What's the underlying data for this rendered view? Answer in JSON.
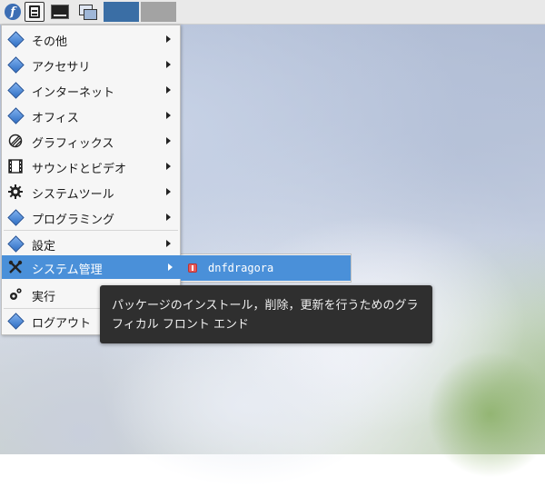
{
  "panel": {
    "launcher_icon": "fedora-icon",
    "files_icon": "file-manager-icon",
    "terminal_icon": "terminal-icon",
    "windows_icon": "show-desktop-icon",
    "workspace_active_color": "#3a6ea5",
    "workspace_inactive_color": "#a3a3a3"
  },
  "menu": {
    "items": [
      {
        "label": "その他",
        "icon": "category-icon",
        "has_submenu": true
      },
      {
        "label": "アクセサリ",
        "icon": "category-icon",
        "has_submenu": true
      },
      {
        "label": "インターネット",
        "icon": "category-icon",
        "has_submenu": true
      },
      {
        "label": "オフィス",
        "icon": "category-icon",
        "has_submenu": true
      },
      {
        "label": "グラフィックス",
        "icon": "graphics-icon",
        "has_submenu": true
      },
      {
        "label": "サウンドとビデオ",
        "icon": "film-icon",
        "has_submenu": true
      },
      {
        "label": "システムツール",
        "icon": "gear-icon",
        "has_submenu": true
      },
      {
        "label": "プログラミング",
        "icon": "category-icon",
        "has_submenu": true
      },
      {
        "label": "設定",
        "icon": "category-icon",
        "has_submenu": true
      },
      {
        "label": "システム管理",
        "icon": "tools-icon",
        "has_submenu": true,
        "active": true
      },
      {
        "label": "実行",
        "icon": "run-icon",
        "has_submenu": false
      },
      {
        "label": "ログアウト",
        "icon": "category-icon",
        "has_submenu": false
      }
    ]
  },
  "submenu": {
    "item_label": "dnfdragora",
    "item_icon": "package-icon"
  },
  "tooltip": {
    "text": "パッケージのインストール，削除，更新を行うためのグラフィカル フロント エンド"
  },
  "colors": {
    "highlight": "#4a90d9",
    "tooltip_bg": "#2f2f2f"
  }
}
